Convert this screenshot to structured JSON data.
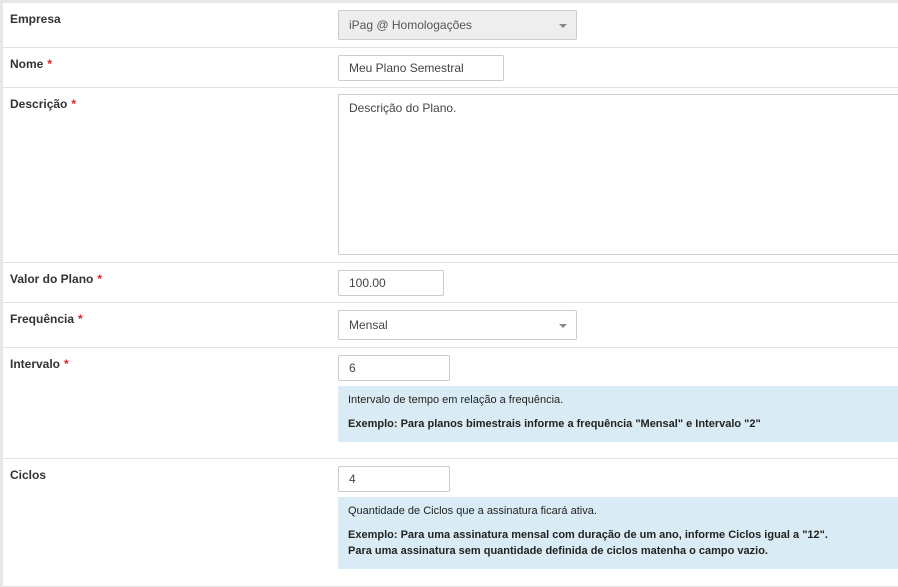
{
  "form": {
    "empresa": {
      "label": "Empresa",
      "value": "iPag @ Homologações"
    },
    "nome": {
      "label": "Nome",
      "required": "*",
      "value": "Meu Plano Semestral"
    },
    "descricao": {
      "label": "Descrição",
      "required": "*",
      "value": "Descrição do Plano."
    },
    "valor": {
      "label": "Valor do Plano",
      "required": "*",
      "value": "100.00"
    },
    "frequencia": {
      "label": "Frequência",
      "required": "*",
      "value": "Mensal"
    },
    "intervalo": {
      "label": "Intervalo",
      "required": "*",
      "value": "6",
      "help_text": "Intervalo de tempo em relação a frequência.",
      "help_example": "Exemplo: Para planos bimestrais informe a frequência \"Mensal\" e Intervalo \"2\""
    },
    "ciclos": {
      "label": "Ciclos",
      "value": "4",
      "help_text": "Quantidade de Ciclos que a assinatura ficará ativa.",
      "help_example_1": "Exemplo: Para uma assinatura mensal com duração de um ano, informe Ciclos igual a \"12\".",
      "help_example_2": "Para uma assinatura sem quantidade definida de ciclos matenha o campo vazio."
    }
  },
  "colors": {
    "required_marker": "#e02020",
    "help_background": "#d9ecf5",
    "disabled_background": "#eeeeee"
  },
  "icons": {
    "select_caret": "caret-down-icon"
  }
}
